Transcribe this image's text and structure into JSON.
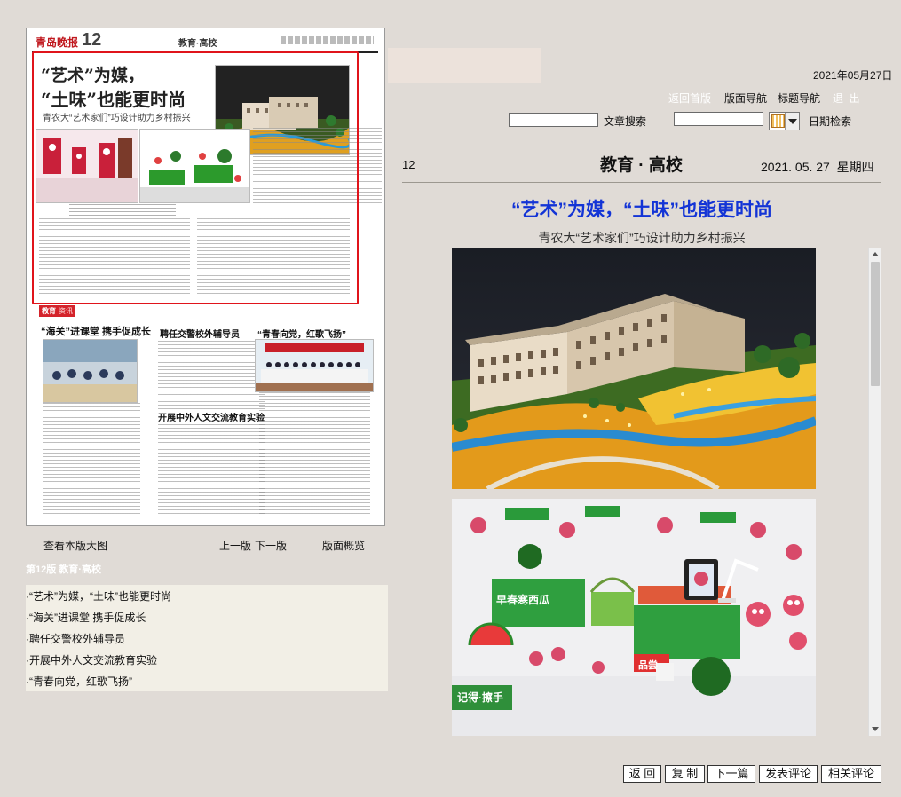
{
  "newspaper": {
    "logo": "青岛晚报",
    "page_number": "12",
    "section": "教育·高校",
    "lead_headline_1": "“艺术”为媒，",
    "lead_headline_2": "“土味”也能更时尚",
    "lead_subhead": "青农大“艺术家们”巧设计助力乡村振兴",
    "box_tag": "教育",
    "box_tag2": "资讯",
    "story2_head": "“海关”进课堂 携手促成长",
    "story3_head": "聘任交警校外辅导员",
    "story4_head": "“青春向党，红歌飞扬”",
    "story5_head": "开展中外人文交流教育实验"
  },
  "left_nav": {
    "view_large": "查看本版大图",
    "prev": "上一版",
    "next": "下一版",
    "overview": "版面概览",
    "section_title": "第12版 教育·高校",
    "articles": [
      "·“艺术”为媒，“土味”也能更时尚",
      "·“海关”进课堂 携手促成长",
      "·聘任交警校外辅导员",
      "·开展中外人文交流教育实验",
      "·“青春向党，红歌飞扬”"
    ]
  },
  "top_nav": {
    "date": "2021年05月27日",
    "back_home": "返回首版",
    "page_nav": "版面导航",
    "title_nav": "标题导航",
    "logout": "退  出",
    "article_search_label": "文章搜索",
    "date_search_label": "日期检索",
    "article_search_value": "",
    "date_search_value": ""
  },
  "article": {
    "page_no": "12",
    "section": "教育 · 高校",
    "date": "2021. 05. 27  星期四",
    "title": "“艺术”为媒，“土味”也能更时尚",
    "subtitle": "青农大“艺术家们”巧设计助力乡村振兴",
    "photo2_sign": "记得·擦手",
    "photo2_box1": "早春寒西瓜",
    "photo2_box2": "品尝"
  },
  "bottom_buttons": [
    "返 回",
    "复 制",
    "下一篇",
    "发表评论",
    "相关评论"
  ],
  "colors": {
    "background": "#e0dbd6",
    "title_blue": "#1334d6",
    "highlight_red": "#e0141b",
    "list_bg": "#f2efe6"
  }
}
